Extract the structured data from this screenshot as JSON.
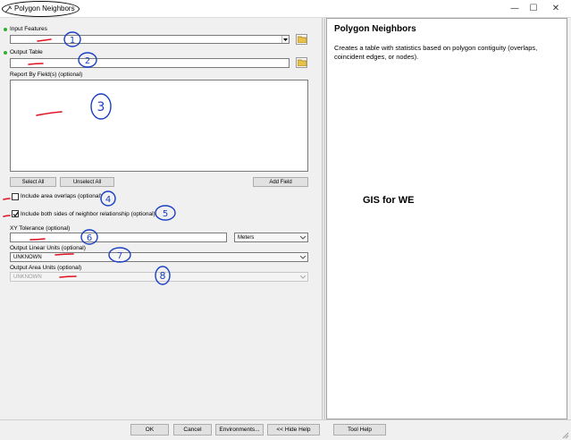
{
  "window": {
    "title": "Polygon Neighbors",
    "minimize": "—",
    "maximize": "☐",
    "close": "✕"
  },
  "form": {
    "input_features_label": "Input Features",
    "output_table_label": "Output Table",
    "report_by_fields_label": "Report By Field(s) (optional)",
    "select_all": "Select All",
    "unselect_all": "Unselect All",
    "add_field": "Add Field",
    "include_area_overlaps": "Include area overlaps (optional)",
    "include_both_sides": "Include both sides of neighbor relationship (optional)",
    "include_area_overlaps_checked": false,
    "include_both_sides_checked": true,
    "xy_tolerance_label": "XY Tolerance (optional)",
    "xy_tolerance_value": "",
    "xy_tolerance_units": "Meters",
    "linear_units_label": "Output Linear Units (optional)",
    "linear_units_value": "UNKNOWN",
    "area_units_label": "Output Area Units (optional)",
    "area_units_value": "UNKNOWN"
  },
  "help": {
    "title": "Polygon Neighbors",
    "body": "Creates a table with statistics based on polygon contiguity (overlaps, coincident edges, or nodes).",
    "watermark": "GIS for WE"
  },
  "buttons": {
    "ok": "OK",
    "cancel": "Cancel",
    "environments": "Environments...",
    "hide_help": "<< Hide Help",
    "tool_help": "Tool Help"
  },
  "annotations": [
    "1",
    "2",
    "3",
    "4",
    "5",
    "6",
    "7",
    "8"
  ],
  "colors": {
    "required_dot": "#30b030",
    "annotation_blue": "#1a3fc4",
    "annotation_red": "#e01020"
  }
}
